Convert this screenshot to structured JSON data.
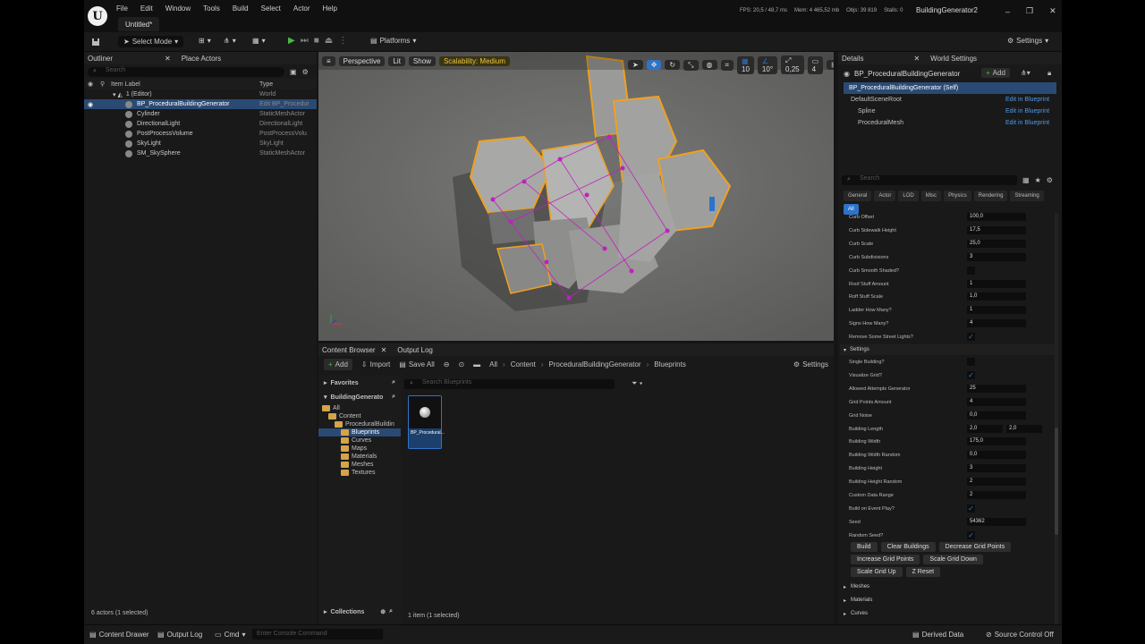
{
  "titlebar": {
    "menu": [
      "File",
      "Edit",
      "Window",
      "Tools",
      "Build",
      "Select",
      "Actor",
      "Help"
    ],
    "tab": "Untitled*",
    "stats": {
      "fps": "FPS: 20,5 / 48,7 ms",
      "mem": "Mem: 4 465,52 mb",
      "objs": "Objs: 39 819",
      "stalls": "Stalls: 0"
    },
    "project": "BuildingGenerator2"
  },
  "toolbar": {
    "select_mode": "Select Mode",
    "platforms": "Platforms",
    "settings": "Settings"
  },
  "outliner": {
    "tab": "Outliner",
    "tab2": "Place Actors",
    "search_placeholder": "Search",
    "col_label": "Item Label",
    "col_type": "Type",
    "world_row": {
      "label": "1 (Editor)",
      "type": "World"
    },
    "rows": [
      {
        "label": "BP_ProceduralBuildingGenerator",
        "type": "Edit BP_Procedur",
        "selected": true
      },
      {
        "label": "Cylinder",
        "type": "StaticMeshActor"
      },
      {
        "label": "DirectionalLight",
        "type": "DirectionalLight"
      },
      {
        "label": "PostProcessVolume",
        "type": "PostProcessVolu"
      },
      {
        "label": "SkyLight",
        "type": "SkyLight"
      },
      {
        "label": "SM_SkySphere",
        "type": "StaticMeshActor"
      }
    ],
    "footer": "6 actors (1 selected)"
  },
  "viewport": {
    "perspective": "Perspective",
    "lit": "Lit",
    "show": "Show",
    "scalability": "Scalability: Medium",
    "grid_snap": "10",
    "rot_snap": "10°",
    "scale_snap": "0,25",
    "cam_speed": "4"
  },
  "content_browser": {
    "tab": "Content Browser",
    "tab2": "Output Log",
    "add": "Add",
    "import": "Import",
    "save_all": "Save All",
    "crumbs": [
      "All",
      "Content",
      "ProceduralBuildingGenerator",
      "Blueprints"
    ],
    "settings": "Settings",
    "favorites": "Favorites",
    "root": "BuildingGenerato",
    "tree": [
      {
        "label": "All",
        "depth": 0
      },
      {
        "label": "Content",
        "depth": 1
      },
      {
        "label": "ProceduralBuildin",
        "depth": 2
      },
      {
        "label": "Blueprints",
        "depth": 3,
        "selected": true
      },
      {
        "label": "Curves",
        "depth": 3
      },
      {
        "label": "Maps",
        "depth": 3
      },
      {
        "label": "Materials",
        "depth": 3
      },
      {
        "label": "Meshes",
        "depth": 3
      },
      {
        "label": "Textures",
        "depth": 3
      }
    ],
    "search_placeholder": "Search Blueprints",
    "asset_label": "BP_Procedural...",
    "collections": "Collections",
    "count": "1 item (1 selected)"
  },
  "details": {
    "tab": "Details",
    "tab2": "World Settings",
    "actor": "BP_ProceduralBuildingGenerator",
    "add": "Add",
    "components": [
      {
        "label": "BP_ProceduralBuildingGenerator (Self)",
        "link": ""
      },
      {
        "label": "DefaultSceneRoot",
        "link": "Edit in Blueprint"
      },
      {
        "label": "Spline",
        "link": "Edit in Blueprint"
      },
      {
        "label": "ProceduralMesh",
        "link": "Edit in Blueprint"
      }
    ],
    "search_placeholder": "Search",
    "cat_tabs": [
      "General",
      "Actor",
      "LOD",
      "Misc",
      "Physics",
      "Rendering",
      "Streaming",
      "All"
    ],
    "props_top": [
      {
        "label": "Curb Offset",
        "value": "100,0"
      },
      {
        "label": "Curb Sidewalk Height",
        "value": "17,5"
      },
      {
        "label": "Curb Scale",
        "value": "25,0"
      },
      {
        "label": "Curb Subdivisions",
        "value": "3"
      },
      {
        "label": "Curb Smooth Shaded?",
        "check": ""
      },
      {
        "label": "Roof Stuff Amount",
        "value": "1"
      },
      {
        "label": "Roff Stuff Scale",
        "value": "1,0"
      },
      {
        "label": "Ladder How Many?",
        "value": "1"
      },
      {
        "label": "Signs How Many?",
        "value": "4"
      },
      {
        "label": "Remove Some Street Lights?",
        "check": "✓"
      }
    ],
    "settings_header": "Settings",
    "props_settings": [
      {
        "label": "Single Building?",
        "check": ""
      },
      {
        "label": "Visualize Grid?",
        "check": "✓"
      },
      {
        "label": "Allowed Attempts Generator",
        "value": "25"
      },
      {
        "label": "Grid Points Amount",
        "value": "4"
      },
      {
        "label": "Grid Noise",
        "value": "0,0"
      },
      {
        "label": "Building Length",
        "value": "2,0",
        "value2": "2,0"
      },
      {
        "label": "Building Width",
        "value": "175,0"
      },
      {
        "label": "Building Width Random",
        "value": "0,0"
      },
      {
        "label": "Building Height",
        "value": "3"
      },
      {
        "label": "Building Height Random",
        "value": "2"
      },
      {
        "label": "Custom Data Range",
        "value": "2"
      },
      {
        "label": "Build on Event Play?",
        "check": "✓"
      },
      {
        "label": "Seed",
        "value": "54362"
      },
      {
        "label": "Random Seed?",
        "check": "✓"
      }
    ],
    "buttons_row1": [
      "Build",
      "Clear Buildings",
      "Decrease Grid Points"
    ],
    "buttons_row2": [
      "Increase Grid Points",
      "Scale Grid Down"
    ],
    "buttons_row3": [
      "Scale Grid Up",
      "Z Reset"
    ],
    "sections_bottom": [
      "Meshes",
      "Materials",
      "Curves"
    ]
  },
  "statusbar": {
    "content_drawer": "Content Drawer",
    "output_log": "Output Log",
    "cmd": "Cmd",
    "console_placeholder": "Enter Console Command",
    "derived": "Derived Data",
    "source": "Source Control Off"
  },
  "colors": {
    "accent": "#2d73c9",
    "selection": "#2a4a73",
    "play": "#4cb848",
    "scalability": "#e8c840",
    "folder": "#d3a44a",
    "outline": "#f0a020",
    "spline_point": "#c020c0"
  }
}
